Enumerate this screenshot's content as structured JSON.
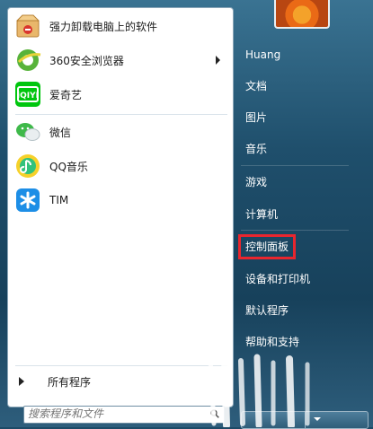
{
  "programs": [
    {
      "label": "强力卸载电脑上的软件",
      "icon": "uninstall-box-icon"
    },
    {
      "label": "360安全浏览器",
      "icon": "360-browser-icon",
      "submenu": true
    },
    {
      "label": "爱奇艺",
      "icon": "iqiyi-icon"
    },
    {
      "label": "微信",
      "icon": "wechat-icon"
    },
    {
      "label": "QQ音乐",
      "icon": "qq-music-icon"
    },
    {
      "label": "TIM",
      "icon": "tim-icon"
    }
  ],
  "all_programs": "所有程序",
  "search": {
    "placeholder": "搜索程序和文件"
  },
  "right": {
    "user": "Huang",
    "items": [
      "文档",
      "图片",
      "音乐",
      "游戏",
      "计算机",
      "控制面板",
      "设备和打印机",
      "默认程序",
      "帮助和支持"
    ]
  },
  "colors": {
    "highlight": "#e8262e",
    "panel_bg": "#1f4f6c"
  }
}
